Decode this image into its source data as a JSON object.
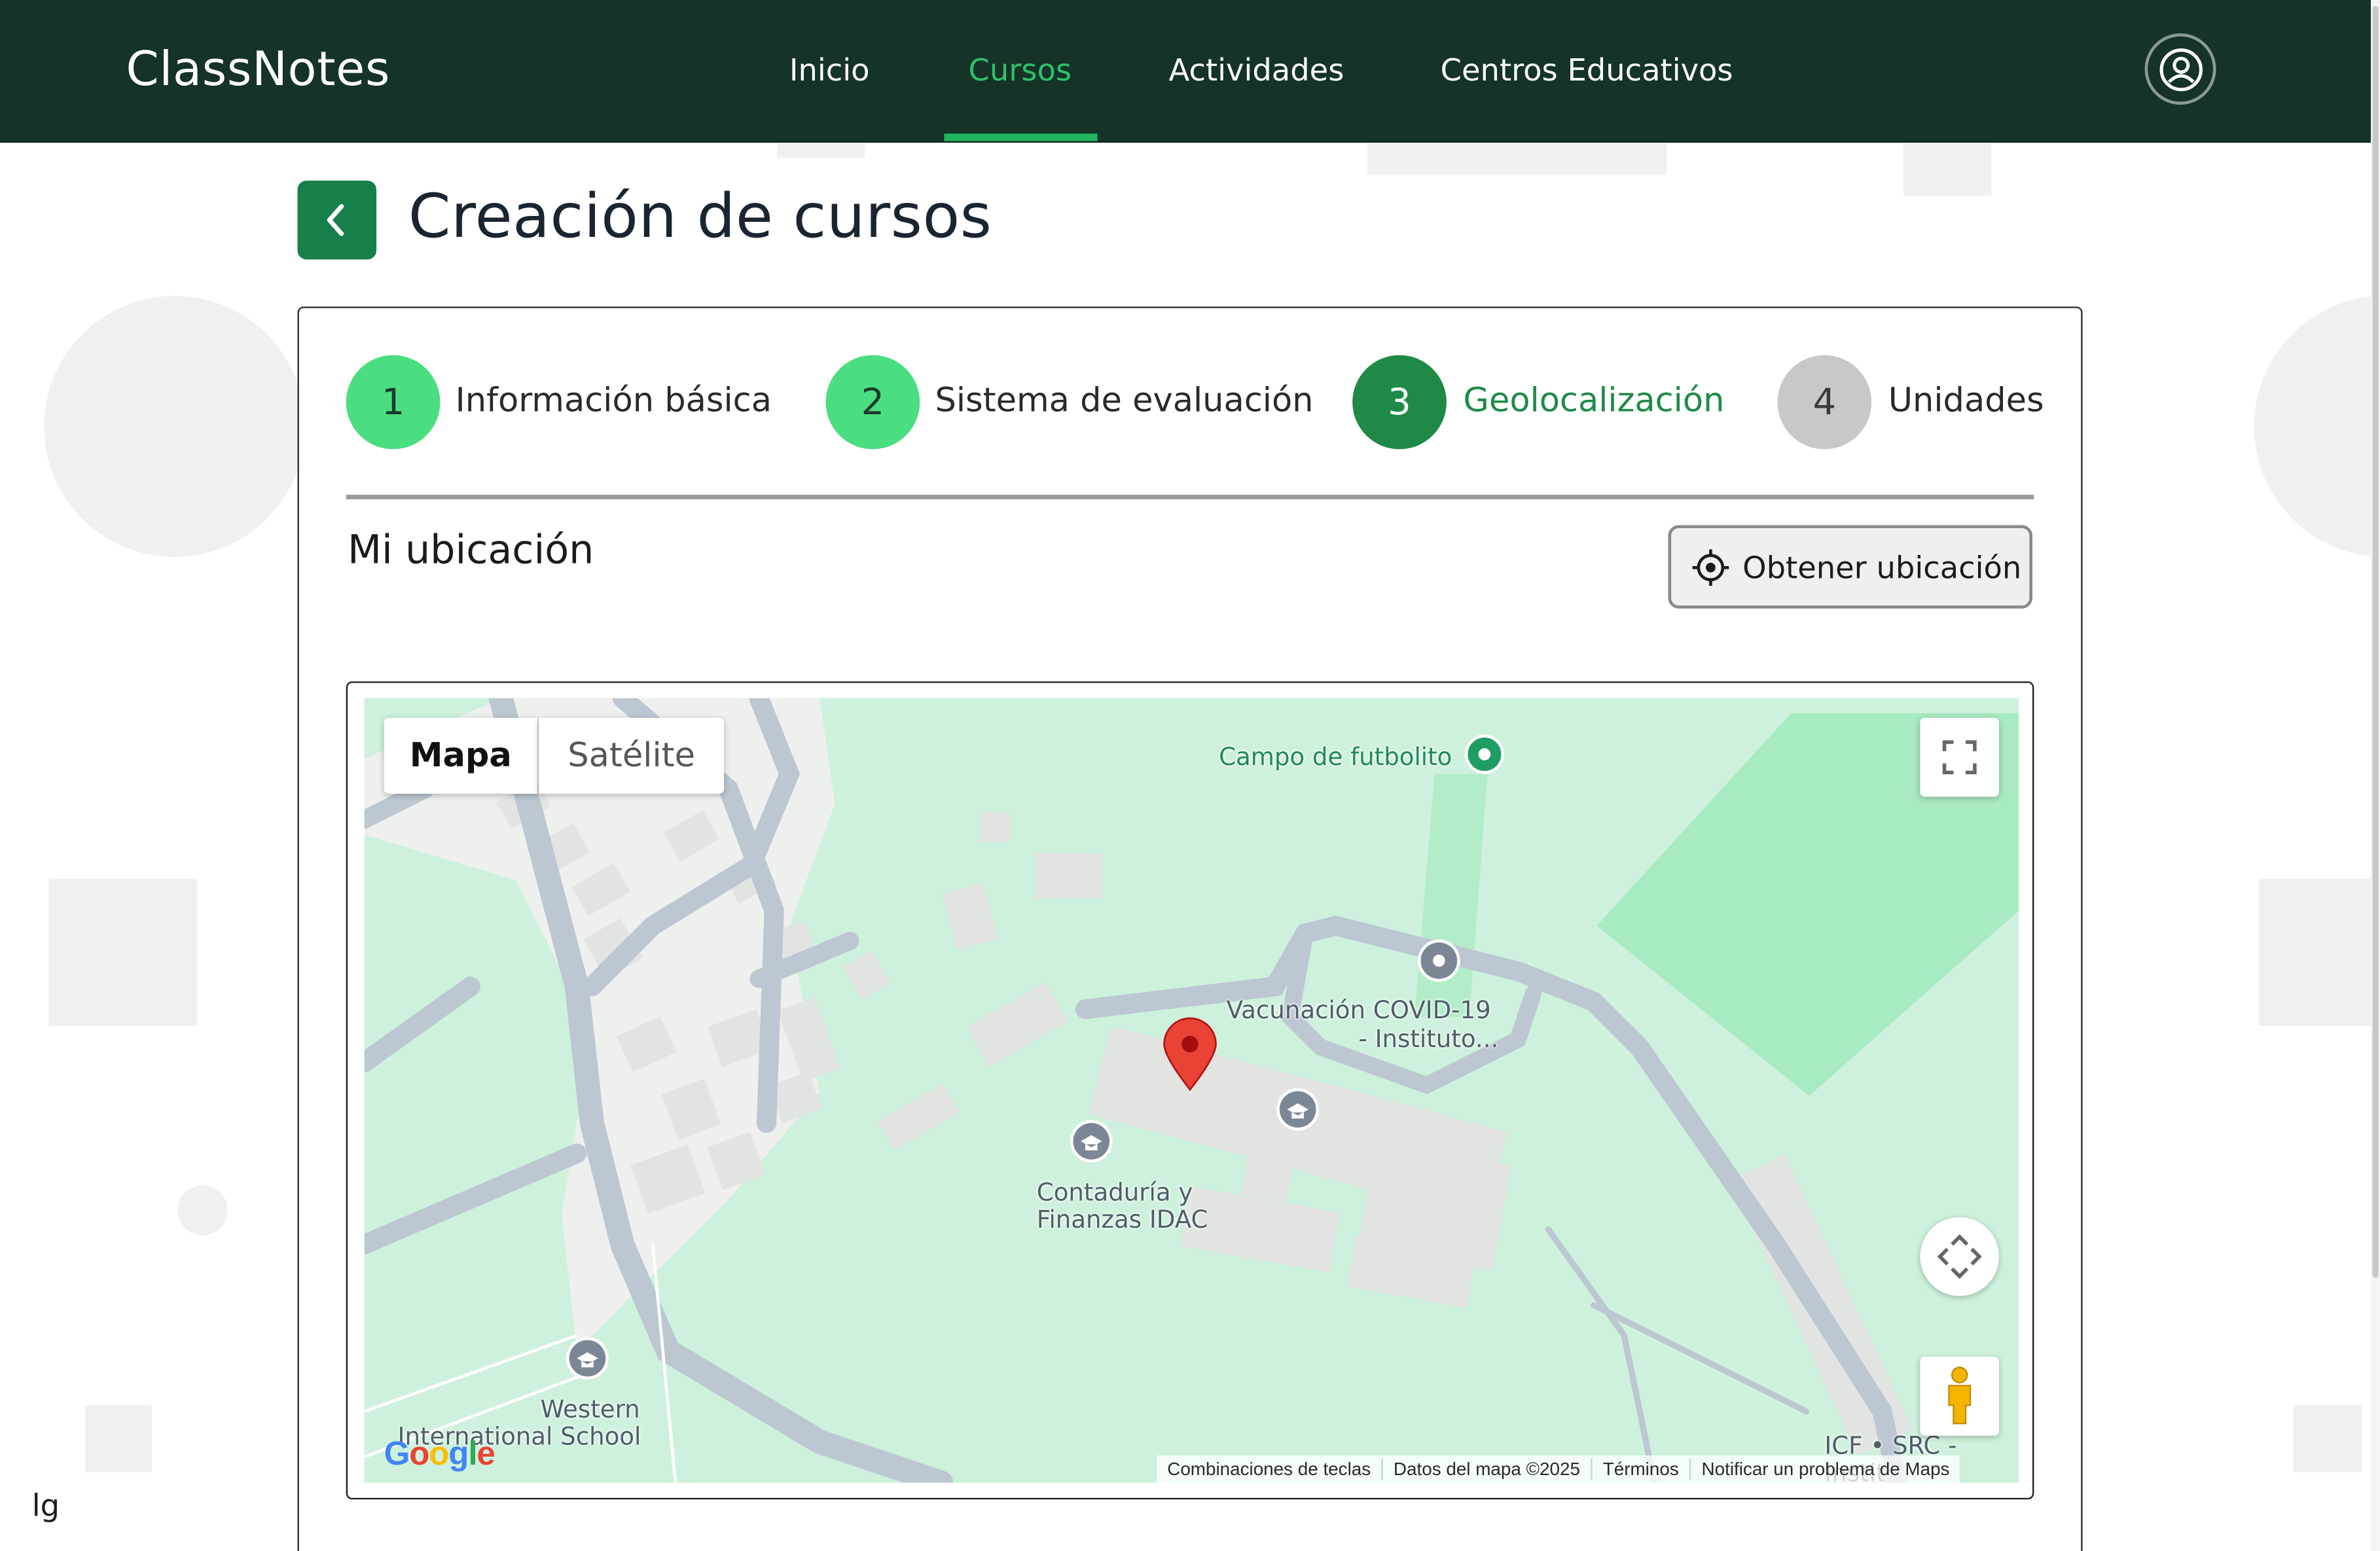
{
  "header": {
    "brand": "ClassNotes",
    "nav": [
      {
        "label": "Inicio",
        "active": false
      },
      {
        "label": "Cursos",
        "active": true
      },
      {
        "label": "Actividades",
        "active": false
      },
      {
        "label": "Centros Educativos",
        "active": false
      }
    ],
    "avatar_icon": "user-circle-icon"
  },
  "page": {
    "title": "Creación de cursos",
    "back_icon": "chevron-left-icon"
  },
  "stepper": {
    "steps": [
      {
        "number": "1",
        "label": "Información básica",
        "state": "done"
      },
      {
        "number": "2",
        "label": "Sistema de evaluación",
        "state": "done"
      },
      {
        "number": "3",
        "label": "Geolocalización",
        "state": "current"
      },
      {
        "number": "4",
        "label": "Unidades",
        "state": "pending"
      }
    ]
  },
  "section": {
    "title": "Mi ubicación",
    "locate_button": "Obtener ubicación",
    "locate_icon": "crosshair-icon"
  },
  "map": {
    "type_tabs": [
      {
        "label": "Mapa",
        "selected": true
      },
      {
        "label": "Satélite",
        "selected": false
      }
    ],
    "places": {
      "campo": "Campo de futbolito",
      "vacunacion_1": "Vacunación COVID-19",
      "vacunacion_2": "- Instituto...",
      "contaduria_1": "Contaduría y",
      "contaduria_2": "Finanzas IDAC",
      "western_1": "Western",
      "western_2": "International School",
      "icf": "ICF • SRC - Instit"
    },
    "logo": "Google",
    "attribution": [
      "Combinaciones de teclas",
      "Datos del mapa ©2025",
      "Términos",
      "Notificar un problema de Maps"
    ]
  },
  "footer_text": "lg",
  "colors": {
    "header_bg": "#153326",
    "accent_green": "#21b35e",
    "step_done": "#4ade80",
    "step_current": "#1f8a47",
    "step_pending": "#c8c8c8",
    "back_button": "#17804a",
    "map_green": "#cdf1dc"
  }
}
